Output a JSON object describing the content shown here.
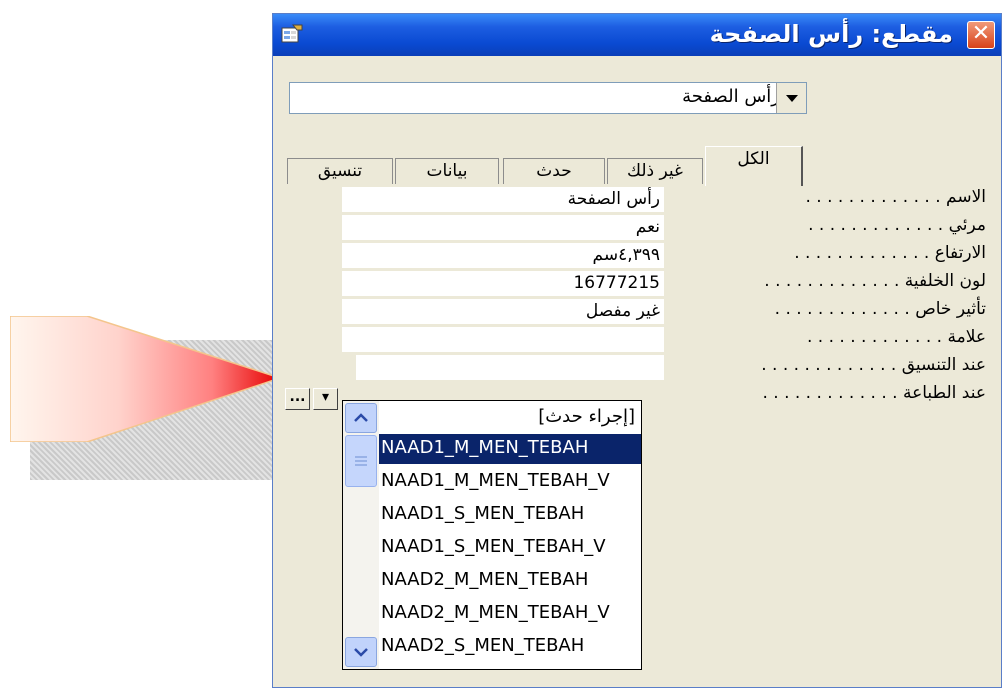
{
  "window": {
    "title": "مقطع: رأس الصفحة",
    "close_label": "✕"
  },
  "selector": {
    "value": "رأس الصفحة"
  },
  "tabs": [
    {
      "label": "الكل",
      "active": true
    },
    {
      "label": "غير ذلك"
    },
    {
      "label": "حدث"
    },
    {
      "label": "بيانات"
    },
    {
      "label": "تنسيق"
    }
  ],
  "properties": [
    {
      "label": "الاسم",
      "value": "رأس الصفحة"
    },
    {
      "label": "مرئي",
      "value": "نعم"
    },
    {
      "label": "الارتفاع",
      "value": "٤,٣٩٩سم"
    },
    {
      "label": "لون الخلفية",
      "value": "16777215"
    },
    {
      "label": "تأثير خاص",
      "value": "غير مفصل"
    },
    {
      "label": "علامة",
      "value": ""
    },
    {
      "label": "عند التنسيق",
      "value": ""
    },
    {
      "label": "عند الطباعة",
      "value": ""
    }
  ],
  "buttons": {
    "builder": "...",
    "dropdown": "▾"
  },
  "dropdown_items": [
    "[إجراء حدث]",
    "NAAD1_M_MEN_TEBAH",
    "NAAD1_M_MEN_TEBAH_V",
    "NAAD1_S_MEN_TEBAH",
    "NAAD1_S_MEN_TEBAH_V",
    "NAAD2_M_MEN_TEBAH",
    "NAAD2_M_MEN_TEBAH_V",
    "NAAD2_S_MEN_TEBAH"
  ],
  "dropdown_selected_index": 1,
  "dots": ". . . . . . . . . . . . ."
}
